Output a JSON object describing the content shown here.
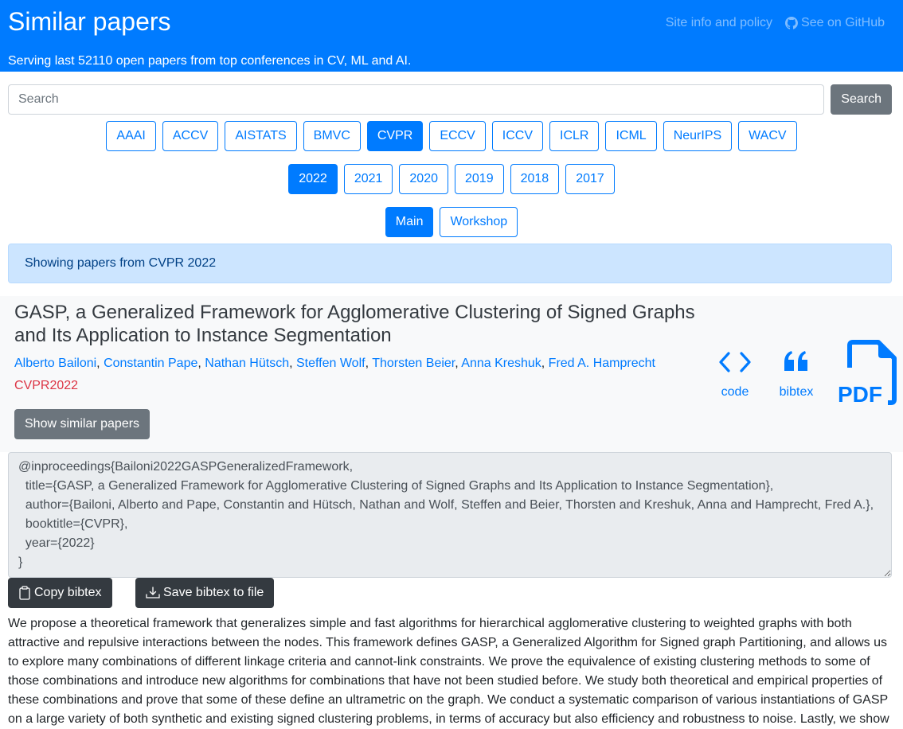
{
  "header": {
    "title": "Similar papers",
    "tagline": "Serving last 52110 open papers from top conferences in CV, ML and AI.",
    "links": {
      "site_info": "Site info and policy",
      "github": "See on GitHub"
    }
  },
  "search": {
    "placeholder": "Search",
    "value": "",
    "button_label": "Search"
  },
  "conferences": [
    {
      "label": "AAAI",
      "active": false
    },
    {
      "label": "ACCV",
      "active": false
    },
    {
      "label": "AISTATS",
      "active": false
    },
    {
      "label": "BMVC",
      "active": false
    },
    {
      "label": "CVPR",
      "active": true
    },
    {
      "label": "ECCV",
      "active": false
    },
    {
      "label": "ICCV",
      "active": false
    },
    {
      "label": "ICLR",
      "active": false
    },
    {
      "label": "ICML",
      "active": false
    },
    {
      "label": "NeurIPS",
      "active": false
    },
    {
      "label": "WACV",
      "active": false
    }
  ],
  "years": [
    {
      "label": "2022",
      "active": true
    },
    {
      "label": "2021",
      "active": false
    },
    {
      "label": "2020",
      "active": false
    },
    {
      "label": "2019",
      "active": false
    },
    {
      "label": "2018",
      "active": false
    },
    {
      "label": "2017",
      "active": false
    }
  ],
  "tracks": [
    {
      "label": "Main",
      "active": true
    },
    {
      "label": "Workshop",
      "active": false
    }
  ],
  "alert": "Showing papers from CVPR 2022",
  "paper": {
    "title": "GASP, a Generalized Framework for Agglomerative Clustering of Signed Graphs and Its Application to Instance Segmentation",
    "authors": [
      "Alberto Bailoni",
      "Constantin Pape",
      "Nathan Hütsch",
      "Steffen Wolf",
      "Thorsten Beier",
      "Anna Kreshuk",
      "Fred A. Hamprecht"
    ],
    "venue": "CVPR2022",
    "similar_button": "Show similar papers",
    "code_label": "code",
    "bibtex_label": "bibtex",
    "pdf_label": "PDF"
  },
  "bibtex": {
    "text": "@inproceedings{Bailoni2022GASPGeneralizedFramework,\n  title={GASP, a Generalized Framework for Agglomerative Clustering of Signed Graphs and Its Application to Instance Segmentation},\n  author={Bailoni, Alberto and Pape, Constantin and Hütsch, Nathan and Wolf, Steffen and Beier, Thorsten and Kreshuk, Anna and Hamprecht, Fred A.},\n  booktitle={CVPR},\n  year={2022}\n}",
    "copy_label": "Copy bibtex",
    "save_label": "Save bibtex to file"
  },
  "abstract": "We propose a theoretical framework that generalizes simple and fast algorithms for hierarchical agglomerative clustering to weighted graphs with both attractive and repulsive interactions between the nodes. This framework defines GASP, a Generalized Algorithm for Signed graph Partitioning, and allows us to explore many combinations of different linkage criteria and cannot-link constraints. We prove the equivalence of existing clustering methods to some of those combinations and introduce new algorithms for combinations that have not been studied before. We study both theoretical and empirical properties of these combinations and prove that some of these define an ultrametric on the graph. We conduct a systematic comparison of various instantiations of GASP on a large variety of both synthetic and existing signed clustering problems, in terms of accuracy but also efficiency and robustness to noise. Lastly, we show"
}
